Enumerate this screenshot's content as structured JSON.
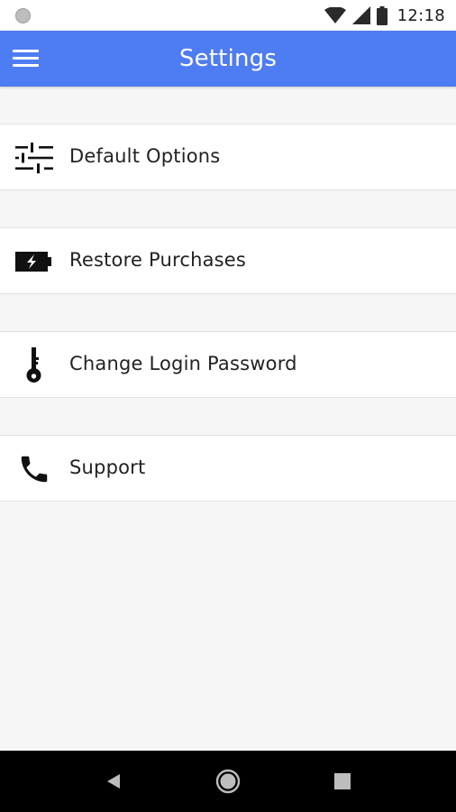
{
  "status_bar": {
    "time": "12:18",
    "icons": [
      "notification-dot-icon",
      "wifi-icon",
      "signal-icon",
      "battery-icon"
    ]
  },
  "app_bar": {
    "title": "Settings",
    "menu_icon": "hamburger-menu-icon",
    "background_color": "#4e7cf2"
  },
  "settings": {
    "items": [
      {
        "label": "Default Options",
        "icon": "sliders-icon"
      },
      {
        "label": "Restore Purchases",
        "icon": "battery-charging-icon"
      },
      {
        "label": "Change Login Password",
        "icon": "key-icon"
      },
      {
        "label": "Support",
        "icon": "phone-icon"
      }
    ]
  },
  "nav_bar": {
    "buttons": [
      "back-icon",
      "home-icon",
      "recents-icon"
    ]
  }
}
